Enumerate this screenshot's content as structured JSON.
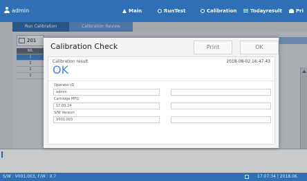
{
  "header": {
    "user": "admin",
    "nav": [
      {
        "label": "Main",
        "icon": "home-icon"
      },
      {
        "label": "RunTest",
        "icon": "circle-icon"
      },
      {
        "label": "Calibration",
        "icon": "circle-icon"
      },
      {
        "label": "Todayresult",
        "icon": "list-icon"
      },
      {
        "label": "Pri",
        "icon": "people-icon"
      }
    ]
  },
  "tabs": [
    "Run Calibration",
    "Calibration Review"
  ],
  "background": {
    "date_prefix": "201",
    "table_header": "NR.",
    "rows": [
      "1",
      "2",
      "1",
      "1"
    ]
  },
  "dialog": {
    "title": "Calibration Check",
    "print_label": "Print",
    "ok_label": "OK",
    "result_label": "Calibration result",
    "result_value": "OK",
    "timestamp": "2018-08-02 16:47:43",
    "fields": [
      {
        "label": "Operator ID",
        "value": "admin"
      },
      {
        "label": "Cartridge MFG",
        "value": "17.03.24"
      },
      {
        "label": "S/W Version",
        "value": "V001.003"
      }
    ]
  },
  "footer": {
    "version": "S/W : V001.003, F/W : 0.7",
    "clock": "17:07:34 | 2018.06."
  },
  "colors": {
    "accent": "#2f6fb5",
    "result_ok": "#4a87c8"
  }
}
